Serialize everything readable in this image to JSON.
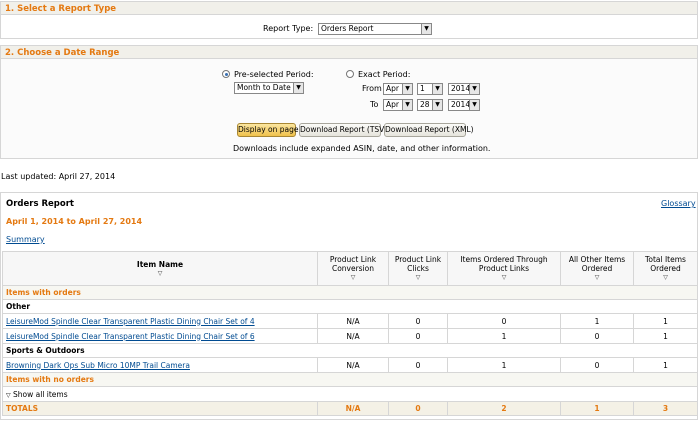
{
  "sections": {
    "report_type": {
      "title": "1. Select a Report Type",
      "label": "Report Type:",
      "value": "Orders Report"
    },
    "date_range": {
      "title": "2. Choose a Date Range",
      "preselected_label": "Pre-selected Period:",
      "preselected_value": "Month to Date",
      "exact_label": "Exact Period:",
      "from_label": "From",
      "to_label": "To",
      "from": {
        "month": "Apr",
        "day": "1",
        "year": "2014"
      },
      "to": {
        "month": "Apr",
        "day": "28",
        "year": "2014"
      },
      "buttons": {
        "display": "Display on page",
        "tsv": "Download Report (TSV)",
        "xml": "Download Report (XML)"
      },
      "note": "Downloads include expanded ASIN, date, and other information."
    }
  },
  "last_updated": "Last updated: April 27, 2014",
  "report": {
    "title": "Orders Report",
    "glossary": "Glossary",
    "date_range": "April 1, 2014 to April 27, 2014",
    "summary": "Summary",
    "columns": [
      "Item Name",
      "Product Link Conversion",
      "Product Link Clicks",
      "Items Ordered Through Product Links",
      "All Other Items Ordered",
      "Total Items Ordered"
    ],
    "group_with_orders": "Items with orders",
    "cat_other": "Other",
    "rows_other": [
      {
        "name": "LeisureMod Spindle Clear Transparent Plastic Dining Chair Set of 4",
        "conv": "N/A",
        "clicks": "0",
        "through": "0",
        "other": "1",
        "total": "1"
      },
      {
        "name": "LeisureMod Spindle Clear Transparent Plastic Dining Chair Set of 6",
        "conv": "N/A",
        "clicks": "0",
        "through": "1",
        "other": "0",
        "total": "1"
      }
    ],
    "cat_sports": "Sports & Outdoors",
    "rows_sports": [
      {
        "name": "Browning Dark Ops Sub Micro 10MP Trail Camera",
        "conv": "N/A",
        "clicks": "0",
        "through": "1",
        "other": "0",
        "total": "1"
      }
    ],
    "group_no_orders": "Items with no orders",
    "show_all": "Show all items",
    "totals": {
      "label": "TOTALS",
      "conv": "N/A",
      "clicks": "0",
      "through": "2",
      "other": "1",
      "total": "3"
    }
  }
}
